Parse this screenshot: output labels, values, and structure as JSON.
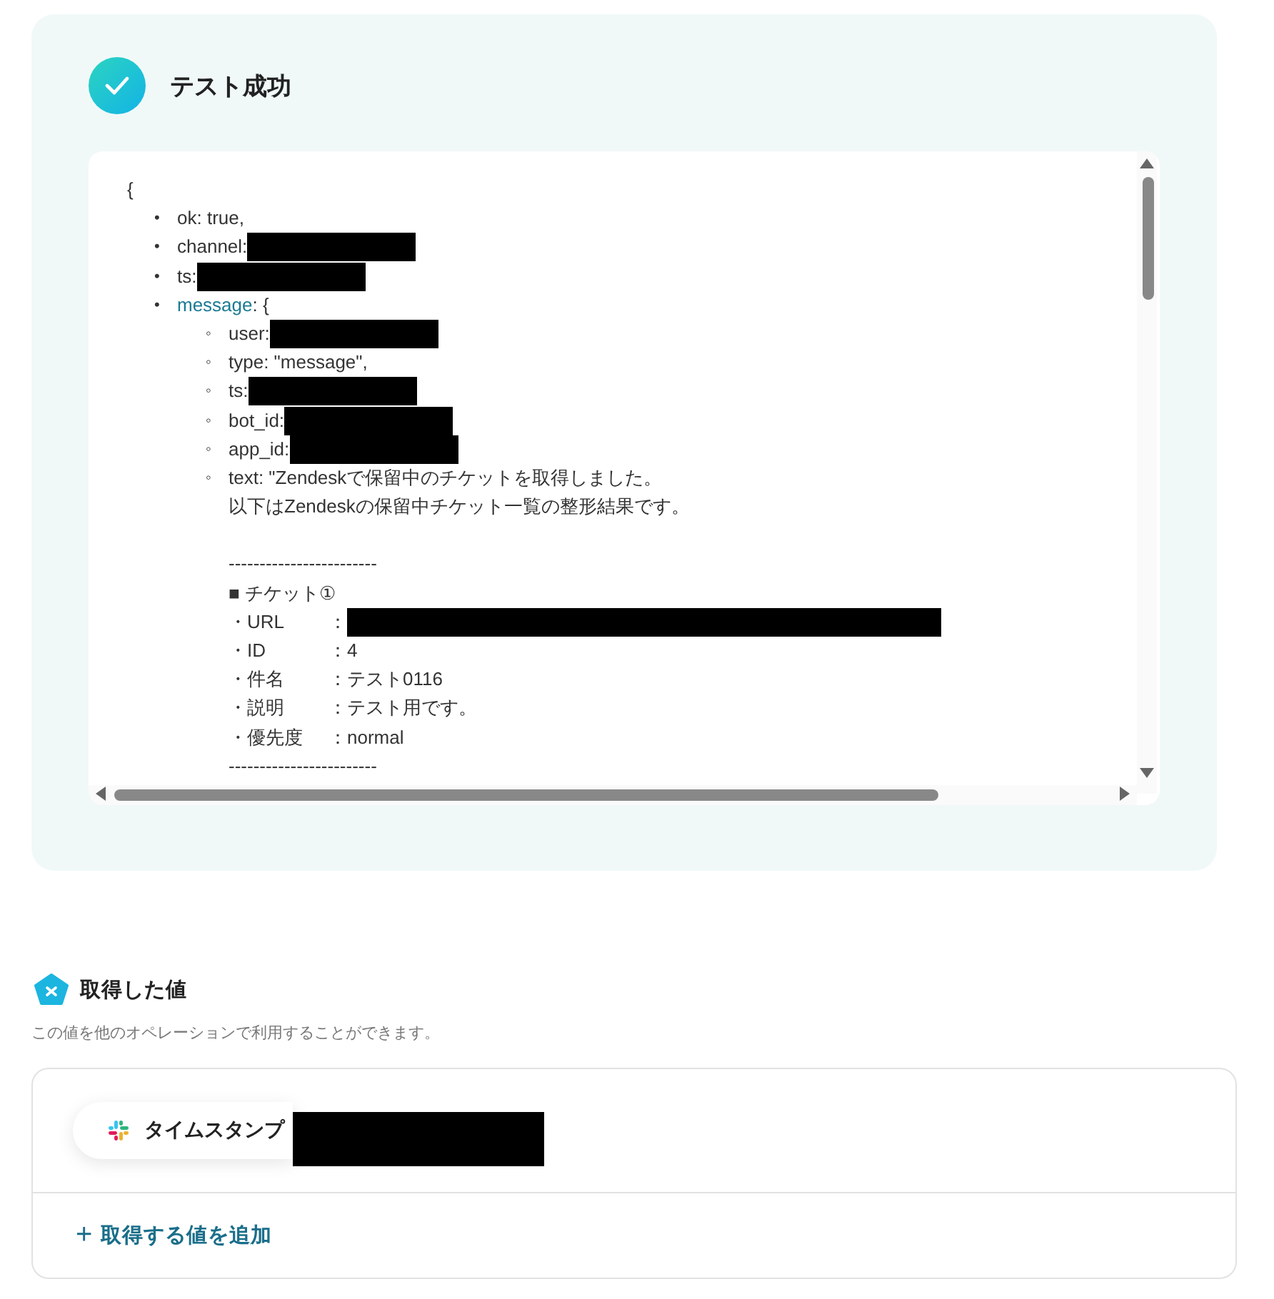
{
  "result": {
    "title": "テスト成功",
    "success": true,
    "code": {
      "open": "{",
      "items": [
        {
          "marker": "•",
          "label": "ok: true,"
        },
        {
          "marker": "•",
          "label": "channel:",
          "redacted": true
        },
        {
          "marker": "•",
          "label": "ts:",
          "redacted": true
        },
        {
          "marker": "•",
          "label": "message",
          "suffix": ": {",
          "kind": "object",
          "children": [
            {
              "marker": "◦",
              "label": "user:",
              "redacted": true
            },
            {
              "marker": "◦",
              "label": "type: \"message\","
            },
            {
              "marker": "◦",
              "label": "ts:",
              "redacted": true
            },
            {
              "marker": "◦",
              "label": "bot_id:",
              "redacted": true
            },
            {
              "marker": "◦",
              "label": "app_id:",
              "redacted": true
            },
            {
              "marker": "◦",
              "label": "text: \"Zendeskで保留中のチケットを取得しました。",
              "lines": [
                {
                  "kind": "text",
                  "text": "以下はZendeskの保留中チケット一覧の整形結果です。"
                },
                {
                  "kind": "text",
                  "text": "------------------------",
                  "spaced": true
                },
                {
                  "kind": "text",
                  "text": "■ チケット①"
                },
                {
                  "kind": "field",
                  "text": "・URL",
                  "value": "：",
                  "redacted": true
                },
                {
                  "kind": "field",
                  "text": "・ID",
                  "value": "：4"
                },
                {
                  "kind": "field",
                  "text": "・件名",
                  "value": "：テスト0116"
                },
                {
                  "kind": "field",
                  "text": "・説明",
                  "value": "：テスト用です。"
                },
                {
                  "kind": "field",
                  "text": "・優先度",
                  "value": "：normal"
                },
                {
                  "kind": "text",
                  "text": "------------------------"
                }
              ]
            }
          ]
        }
      ]
    }
  },
  "fetched": {
    "title": "取得した値",
    "description": "この値を他のオペレーションで利用することができます。",
    "values": [
      {
        "label": "タイムスタンプ",
        "redacted": true
      }
    ],
    "add_button": {
      "icon": "+",
      "label": "取得する値を追加"
    }
  }
}
